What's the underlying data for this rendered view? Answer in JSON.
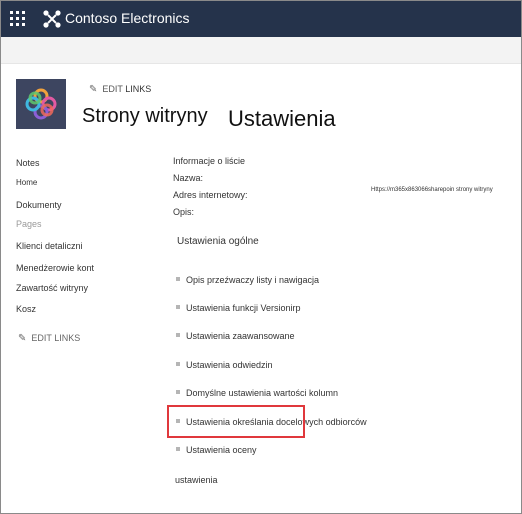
{
  "suite": {
    "app_name": "Contoso Electronics",
    "waffle_icon": "app-launcher-icon",
    "brand_icon": "contoso-logo-icon",
    "bar_color": "#25334b"
  },
  "site": {
    "edit_links_label": "EDIT",
    "edit_links_suffix": "LINKS",
    "site_title": "Strony witryny",
    "page_title": "Ustawienia",
    "logo_bg": "#3d4560"
  },
  "nav": {
    "items": [
      {
        "label": "Notes"
      },
      {
        "label": "Home"
      },
      {
        "label": "Dokumenty"
      },
      {
        "label": "Pages"
      },
      {
        "label": "Klienci detaliczni"
      },
      {
        "label": "Menedżerowie kont"
      },
      {
        "label": "Zawartość witryny"
      },
      {
        "label": "Kosz"
      }
    ],
    "edit_links_label": "EDIT LINKS"
  },
  "info": {
    "header": "Informacje o liście",
    "name_label": "Nazwa:",
    "address_label": "Adres internetowy:",
    "address_value": "Https://m365x863066sharepoin strony witryny",
    "desc_label": "Opis:"
  },
  "general": {
    "header": "Ustawienia ogólne",
    "links": [
      {
        "label": "Opis przeźwaczy listy i nawigacja"
      },
      {
        "label": "Ustawienia funkcji Versionirp"
      },
      {
        "label": "Ustawienia zaawansowane"
      },
      {
        "label": "Ustawienia odwiedzin"
      },
      {
        "label": "Domyślne ustawienia wartości kolumn"
      },
      {
        "label": "Ustawienia określania docelowych odbiorców"
      },
      {
        "label": "Ustawienia oceny"
      }
    ],
    "footer_label": "ustawienia",
    "highlight_color": "#e0383c"
  }
}
